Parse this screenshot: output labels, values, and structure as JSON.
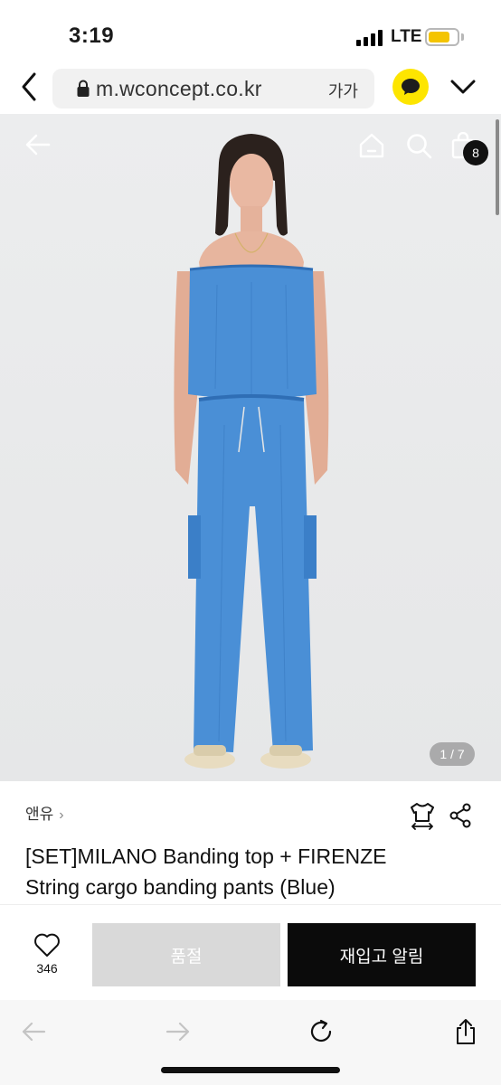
{
  "status_bar": {
    "time": "3:19",
    "network": "LTE",
    "battery_level": 0.75,
    "battery_color": "#f4c400",
    "signal_bars": 4
  },
  "browser": {
    "url": "m.wconcept.co.kr",
    "text_size_button": "가가",
    "icons": [
      "back-chevron-icon",
      "lock-icon",
      "kakao-chat-icon",
      "chevron-down-icon"
    ],
    "kakao_color": "#fde500"
  },
  "product_image": {
    "icons": [
      "arrow-left-icon",
      "home-icon",
      "search-icon",
      "shopping-bag-icon"
    ],
    "cart_count": "8",
    "page_counter": "1 / 7",
    "garment_color": "#4a8fd6"
  },
  "product": {
    "brand": "앤유",
    "title_line1": "[SET]MILANO Banding top + FIRENZE",
    "title_line2": "String cargo banding pants (Blue)"
  },
  "actions": {
    "wishlist_count": "346",
    "sold_out_label": "품절",
    "restock_label": "재입고 알림"
  },
  "safari_toolbar": {
    "icons": [
      "back-arrow-icon",
      "forward-arrow-icon",
      "reload-icon",
      "share-icon"
    ]
  }
}
